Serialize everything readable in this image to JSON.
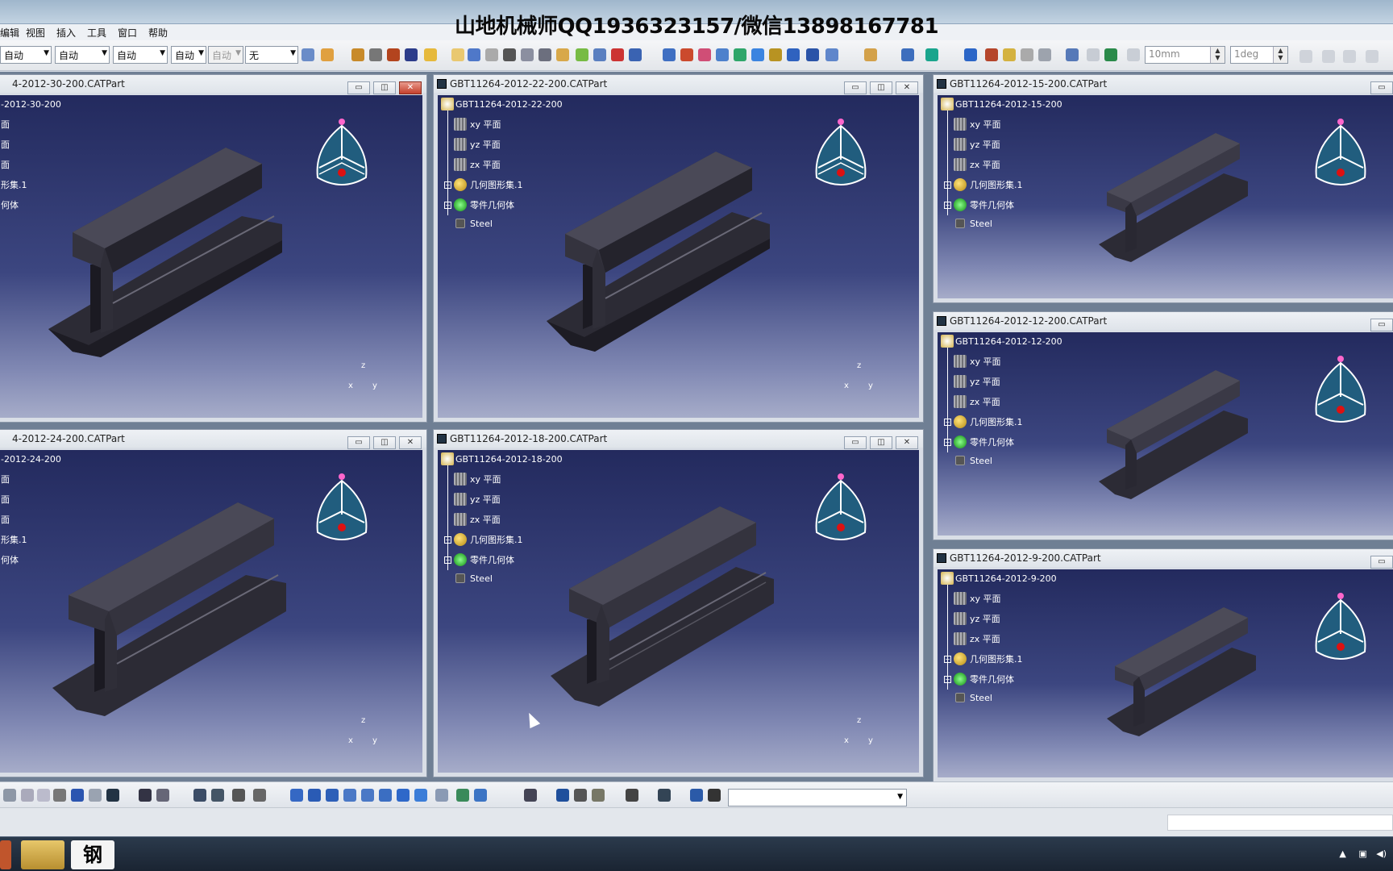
{
  "overlay": {
    "text": "山地机械师QQ1936323157/微信13898167781"
  },
  "menu": {
    "items": [
      "编辑",
      "视图",
      "插入",
      "工具",
      "窗口",
      "帮助"
    ]
  },
  "toolbar": {
    "combos": [
      "自动",
      "自动",
      "自动",
      "自动",
      "自动",
      "无"
    ],
    "length_value": "10mm",
    "angle_value": "1deg"
  },
  "windows": [
    {
      "title": "4-2012-30-200.CATPart",
      "root": "-2012-30-200",
      "tree": [
        "面",
        "面",
        "面",
        "形集.1",
        "何体"
      ]
    },
    {
      "title": "GBT11264-2012-22-200.CATPart",
      "root": "GBT11264-2012-22-200",
      "tree": [
        "xy 平面",
        "yz 平面",
        "zx 平面",
        "几何图形集.1",
        "零件几何体",
        "Steel"
      ]
    },
    {
      "title": "GBT11264-2012-15-200.CATPart",
      "root": "GBT11264-2012-15-200",
      "tree": [
        "xy 平面",
        "yz 平面",
        "zx 平面",
        "几何图形集.1",
        "零件几何体",
        "Steel"
      ]
    },
    {
      "title": "GBT11264-2012-12-200.CATPart",
      "root": "GBT11264-2012-12-200",
      "tree": [
        "xy 平面",
        "yz 平面",
        "zx 平面",
        "几何图形集.1",
        "零件几何体",
        "Steel"
      ]
    },
    {
      "title": "4-2012-24-200.CATPart",
      "root": "-2012-24-200",
      "tree": [
        "面",
        "面",
        "面",
        "形集.1",
        "何体"
      ]
    },
    {
      "title": "GBT11264-2012-18-200.CATPart",
      "root": "GBT11264-2012-18-200",
      "tree": [
        "xy 平面",
        "yz 平面",
        "zx 平面",
        "几何图形集.1",
        "零件几何体",
        "Steel"
      ]
    },
    {
      "title": "GBT11264-2012-9-200.CATPart",
      "root": "GBT11264-2012-9-200",
      "tree": [
        "xy 平面",
        "yz 平面",
        "zx 平面",
        "几何图形集.1",
        "零件几何体",
        "Steel"
      ]
    }
  ],
  "axis_labels": {
    "z": "z",
    "x": "x",
    "y": "y"
  },
  "window_buttons": {
    "min": "▭",
    "max": "◫",
    "close": "✕"
  },
  "taskbar": {
    "app_label": "钢"
  }
}
